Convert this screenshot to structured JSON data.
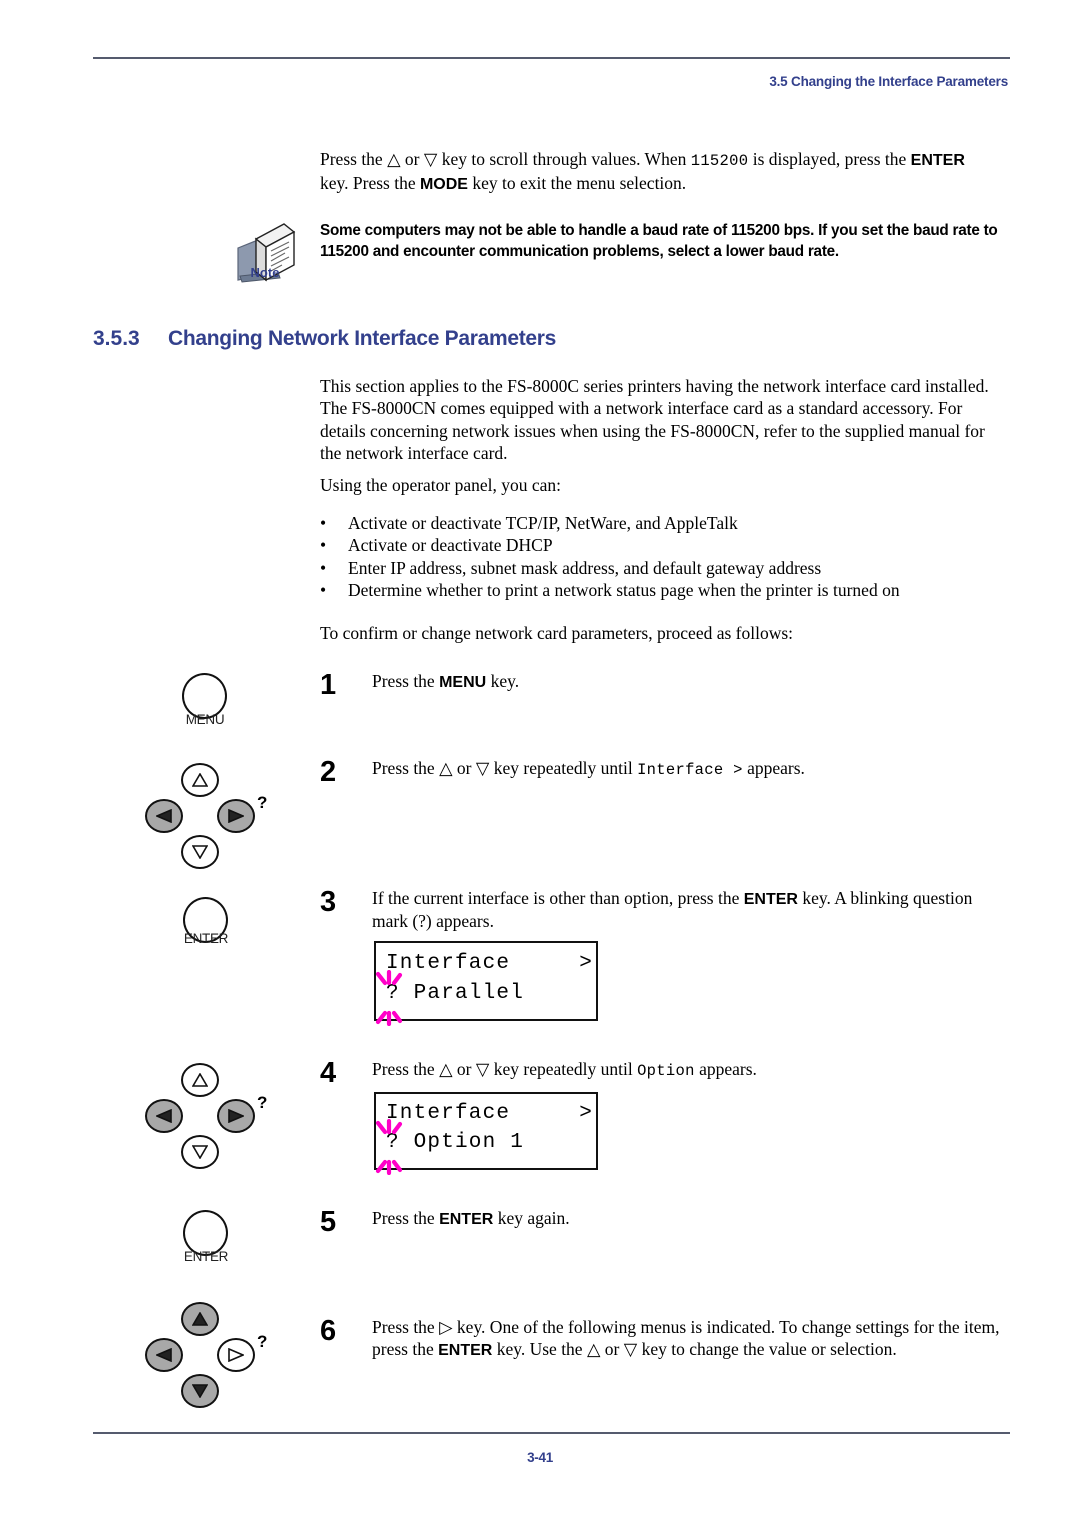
{
  "header": {
    "title": "3.5 Changing the Interface Parameters"
  },
  "footer": {
    "page_number": "3-41"
  },
  "colors": {
    "heading_blue": "#33408c",
    "rule_gray": "#555b6e",
    "key_gray": "#a8a8a8",
    "blink_magenta": "#ff00c8"
  },
  "intro": {
    "line1_a": "Press the ",
    "line1_up": "△",
    "line1_b": " or ",
    "line1_down": "▽",
    "line1_c": " key to scroll through values. When ",
    "line1_value": "115200",
    "line1_d": " is displayed, press the ",
    "line1_enter": "ENTER",
    "line2_a": "key. Press the ",
    "line2_mode": "MODE",
    "line2_b": " key to exit the menu selection."
  },
  "note": {
    "icon": "note-booklet-icon",
    "label": "Note",
    "text": "Some computers may not be able to handle a baud rate of 115200 bps. If you set the baud rate to 115200 and encounter communication problems, select a lower baud rate."
  },
  "section": {
    "number": "3.5.3",
    "title": "Changing Network Interface Parameters",
    "paragraph": "This section applies to the FS-8000C series printers having the network interface card installed. The FS-8000CN comes equipped with a network interface card as a standard accessory. For details concerning network issues when using the FS-8000CN, refer to the supplied manual for the network interface card.",
    "lead_in": "Using the operator panel, you can:",
    "bullets": [
      "Activate or deactivate TCP/IP, NetWare, and AppleTalk",
      "Activate or deactivate DHCP",
      "Enter IP address, subnet mask address, and default gateway address",
      "Determine whether to print a network status page when the printer is turned on"
    ],
    "bullet_marker": "•",
    "closing": "To confirm or change network card parameters, proceed as follows:"
  },
  "steps": [
    {
      "number": "1",
      "key_icon": "menu-key-icon",
      "key_caption": "MENU",
      "text_a": "Press the ",
      "text_bold": "MENU",
      "text_b": " key."
    },
    {
      "number": "2",
      "key_icon": "arrow-key-cluster-icon",
      "text_a": "Press the ",
      "up": "△",
      "text_b": " or ",
      "down": "▽",
      "text_c": " key repeatedly until ",
      "mono": "Interface >",
      "text_d": " appears."
    },
    {
      "number": "3",
      "key_icon": "enter-key-icon",
      "key_caption": "ENTER",
      "text_a": "If the current interface is other than option, press the ",
      "text_bold": "ENTER",
      "text_b": " key. A blinking question mark (?) appears."
    },
    {
      "number": "4",
      "key_icon": "arrow-key-cluster-icon",
      "text_a": "Press the ",
      "up": "△",
      "text_b": " or ",
      "down": "▽",
      "text_c": " key repeatedly until ",
      "mono": "Option",
      "text_d": " appears."
    },
    {
      "number": "5",
      "key_icon": "enter-key-icon",
      "key_caption": "ENTER",
      "text_a": "Press the ",
      "text_bold": "ENTER",
      "text_b": " key again."
    },
    {
      "number": "6",
      "key_icon": "arrow-key-cluster-icon",
      "text_a": "Press the ",
      "right": "▷",
      "text_b": " key. One of the following menus is indicated. To change settings for the item, press the ",
      "text_bold": "ENTER",
      "text_c": " key. Use the ",
      "up": "△",
      "text_d": " or ",
      "down": "▽",
      "text_e": " key to change the value or selection."
    }
  ],
  "lcd_displays": [
    {
      "id": "lcd-interface-parallel",
      "line1": "Interface     >",
      "line2": "? Parallel",
      "blinking_char": "?"
    },
    {
      "id": "lcd-interface-option1",
      "line1": "Interface     >",
      "line2": "? Option 1",
      "blinking_char": "?"
    }
  ],
  "key_clusters": [
    {
      "id": "cluster-step2",
      "up": "white",
      "down": "white",
      "left": "gray",
      "right": "gray",
      "question": "?"
    },
    {
      "id": "cluster-step4",
      "up": "white",
      "down": "white",
      "left": "gray",
      "right": "gray",
      "question": "?"
    },
    {
      "id": "cluster-step6",
      "up": "gray",
      "down": "gray",
      "left": "gray",
      "right": "white",
      "question": "?"
    }
  ]
}
